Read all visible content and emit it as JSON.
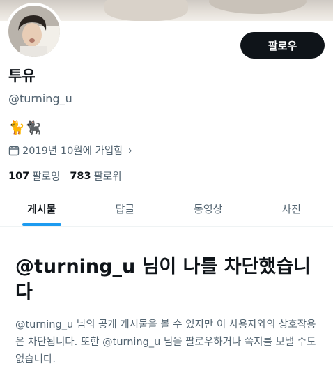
{
  "profile": {
    "display_name": "투유",
    "handle": "@turning_u",
    "bio": "🐈🐈‍⬛",
    "joined": "2019년 10월에 가입함",
    "following_count": "107",
    "following_label": "팔로잉",
    "followers_count": "783",
    "followers_label": "팔로워"
  },
  "actions": {
    "follow_label": "팔로우"
  },
  "tabs": [
    {
      "label": "게시물",
      "active": true
    },
    {
      "label": "답글",
      "active": false
    },
    {
      "label": "동영상",
      "active": false
    },
    {
      "label": "사진",
      "active": false
    }
  ],
  "blocked": {
    "title": "@turning_u 님이 나를 차단했습니다",
    "description": "@turning_u 님의 공개 게시물을 볼 수 있지만 이 사용자와의 상호작용은 차단됩니다. 또한 @turning_u 님을 팔로우하거나 쪽지를 보낼 수도 없습니다."
  },
  "colors": {
    "primary_text": "#0f1419",
    "secondary_text": "#536471",
    "accent": "#1d9bf0",
    "button_bg": "#0f1419"
  },
  "icons": {
    "calendar": "calendar-icon",
    "chevron": "chevron-right-icon"
  }
}
